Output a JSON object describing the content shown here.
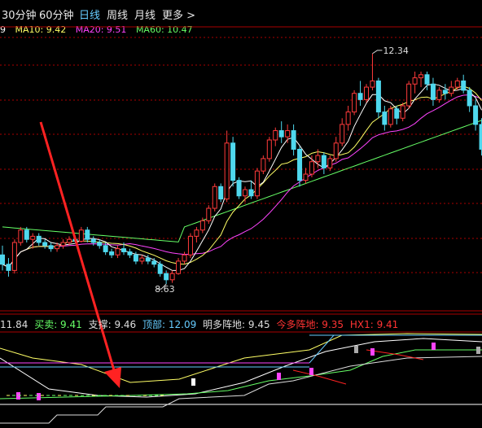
{
  "tabs": [
    {
      "label": "30分钟",
      "active": false
    },
    {
      "label": "60分钟",
      "active": false
    },
    {
      "label": "日线",
      "active": true
    },
    {
      "label": "周线",
      "active": false
    },
    {
      "label": "月线",
      "active": false
    },
    {
      "label": "更多 >",
      "active": false
    }
  ],
  "ma_legend": {
    "prefix": "9",
    "items": [
      {
        "label": "MA10: 9.42",
        "color": "#ffff66"
      },
      {
        "label": "MA20: 9.51",
        "color": "#ff44ff"
      },
      {
        "label": "MA60: 10.47",
        "color": "#66ff66"
      }
    ]
  },
  "price_annotations": {
    "high": "12.34",
    "low": "8.63"
  },
  "indicator_legend": [
    {
      "label": "11.84",
      "color": "#dddddd"
    },
    {
      "label": "买卖: 9.41",
      "color": "#66ff66"
    },
    {
      "label": "支撑: 9.46",
      "color": "#dddddd"
    },
    {
      "label": "顶部: 12.09",
      "color": "#66ccff"
    },
    {
      "label": "明多阵地: 9.45",
      "color": "#dddddd"
    },
    {
      "label": "今多阵地: 9.35",
      "color": "#ff3333"
    },
    {
      "label": "HX1: 9.41",
      "color": "#ff3333"
    }
  ],
  "colors": {
    "up": "#ff3b3b",
    "down": "#4fd8ee",
    "ma5": "#ffffff",
    "ma10": "#ffff66",
    "ma20": "#ff44ff",
    "ma60": "#66ff66",
    "grid": "#aa0000",
    "arrow": "#ff2222"
  },
  "chart_data": {
    "type": "candlestick",
    "y_range": [
      8.2,
      12.6
    ],
    "ohlc": [
      [
        9.1,
        9.25,
        8.85,
        8.95
      ],
      [
        8.95,
        9.05,
        8.75,
        8.85
      ],
      [
        8.85,
        9.35,
        8.8,
        9.3
      ],
      [
        9.3,
        9.55,
        9.25,
        9.5
      ],
      [
        9.5,
        9.55,
        9.3,
        9.35
      ],
      [
        9.35,
        9.45,
        9.2,
        9.4
      ],
      [
        9.4,
        9.45,
        9.25,
        9.3
      ],
      [
        9.3,
        9.35,
        9.2,
        9.25
      ],
      [
        9.25,
        9.3,
        9.15,
        9.2
      ],
      [
        9.2,
        9.3,
        9.15,
        9.25
      ],
      [
        9.25,
        9.35,
        9.2,
        9.3
      ],
      [
        9.3,
        9.4,
        9.25,
        9.35
      ],
      [
        9.35,
        9.4,
        9.28,
        9.32
      ],
      [
        9.32,
        9.55,
        9.3,
        9.5
      ],
      [
        9.5,
        9.55,
        9.3,
        9.35
      ],
      [
        9.35,
        9.4,
        9.25,
        9.3
      ],
      [
        9.3,
        9.35,
        9.2,
        9.25
      ],
      [
        9.25,
        9.3,
        9.1,
        9.15
      ],
      [
        9.15,
        9.2,
        9.05,
        9.1
      ],
      [
        9.1,
        9.25,
        9.05,
        9.2
      ],
      [
        9.2,
        9.3,
        9.1,
        9.15
      ],
      [
        9.15,
        9.2,
        9.05,
        9.1
      ],
      [
        9.1,
        9.15,
        8.95,
        9.0
      ],
      [
        9.0,
        9.1,
        8.95,
        9.05
      ],
      [
        9.05,
        9.1,
        8.95,
        9.0
      ],
      [
        9.0,
        9.05,
        8.9,
        8.95
      ],
      [
        8.95,
        9.0,
        8.75,
        8.8
      ],
      [
        8.8,
        8.85,
        8.63,
        8.7
      ],
      [
        8.7,
        8.85,
        8.65,
        8.8
      ],
      [
        8.8,
        9.05,
        8.78,
        9.0
      ],
      [
        9.0,
        9.15,
        8.95,
        9.1
      ],
      [
        9.1,
        9.45,
        9.05,
        9.4
      ],
      [
        9.4,
        9.55,
        9.3,
        9.5
      ],
      [
        9.5,
        9.7,
        9.45,
        9.65
      ],
      [
        9.65,
        9.9,
        9.6,
        9.85
      ],
      [
        9.85,
        10.25,
        9.8,
        10.2
      ],
      [
        10.2,
        10.25,
        9.95,
        10.0
      ],
      [
        10.0,
        11.1,
        9.95,
        10.9
      ],
      [
        10.9,
        11.0,
        10.2,
        10.3
      ],
      [
        10.3,
        10.35,
        10.0,
        10.05
      ],
      [
        10.05,
        10.2,
        9.95,
        10.15
      ],
      [
        10.15,
        10.3,
        10.0,
        10.05
      ],
      [
        10.05,
        10.5,
        10.0,
        10.45
      ],
      [
        10.45,
        10.7,
        10.4,
        10.65
      ],
      [
        10.65,
        11.0,
        10.6,
        10.95
      ],
      [
        10.95,
        11.15,
        10.85,
        11.1
      ],
      [
        11.1,
        11.25,
        10.9,
        11.0
      ],
      [
        11.0,
        11.2,
        10.9,
        11.1
      ],
      [
        11.1,
        11.2,
        10.7,
        10.8
      ],
      [
        10.8,
        10.85,
        10.2,
        10.3
      ],
      [
        10.3,
        10.5,
        10.25,
        10.4
      ],
      [
        10.4,
        10.7,
        10.35,
        10.6
      ],
      [
        10.6,
        10.8,
        10.5,
        10.7
      ],
      [
        10.7,
        10.75,
        10.4,
        10.5
      ],
      [
        10.5,
        10.7,
        10.45,
        10.65
      ],
      [
        10.65,
        11.0,
        10.6,
        10.9
      ],
      [
        10.9,
        11.3,
        10.85,
        11.2
      ],
      [
        11.2,
        11.5,
        11.1,
        11.4
      ],
      [
        11.4,
        11.75,
        11.35,
        11.7
      ],
      [
        11.7,
        11.9,
        11.5,
        11.6
      ],
      [
        11.6,
        11.85,
        11.55,
        11.8
      ],
      [
        11.8,
        12.34,
        11.75,
        11.9
      ],
      [
        11.9,
        11.95,
        11.3,
        11.4
      ],
      [
        11.4,
        11.5,
        11.1,
        11.2
      ],
      [
        11.2,
        11.5,
        11.15,
        11.45
      ],
      [
        11.45,
        11.5,
        11.2,
        11.3
      ],
      [
        11.3,
        11.55,
        11.25,
        11.5
      ],
      [
        11.5,
        11.9,
        11.45,
        11.85
      ],
      [
        11.85,
        12.05,
        11.7,
        11.95
      ],
      [
        11.95,
        12.05,
        11.8,
        12.0
      ],
      [
        12.0,
        12.05,
        11.75,
        11.85
      ],
      [
        11.85,
        11.95,
        11.5,
        11.6
      ],
      [
        11.6,
        11.8,
        11.55,
        11.75
      ],
      [
        11.75,
        11.85,
        11.6,
        11.7
      ],
      [
        11.7,
        11.9,
        11.65,
        11.8
      ],
      [
        11.8,
        11.95,
        11.75,
        11.9
      ],
      [
        11.9,
        12.0,
        11.7,
        11.75
      ],
      [
        11.75,
        11.8,
        11.4,
        11.5
      ],
      [
        11.5,
        11.6,
        11.1,
        11.2
      ],
      [
        11.2,
        11.3,
        10.7,
        10.8
      ]
    ]
  }
}
